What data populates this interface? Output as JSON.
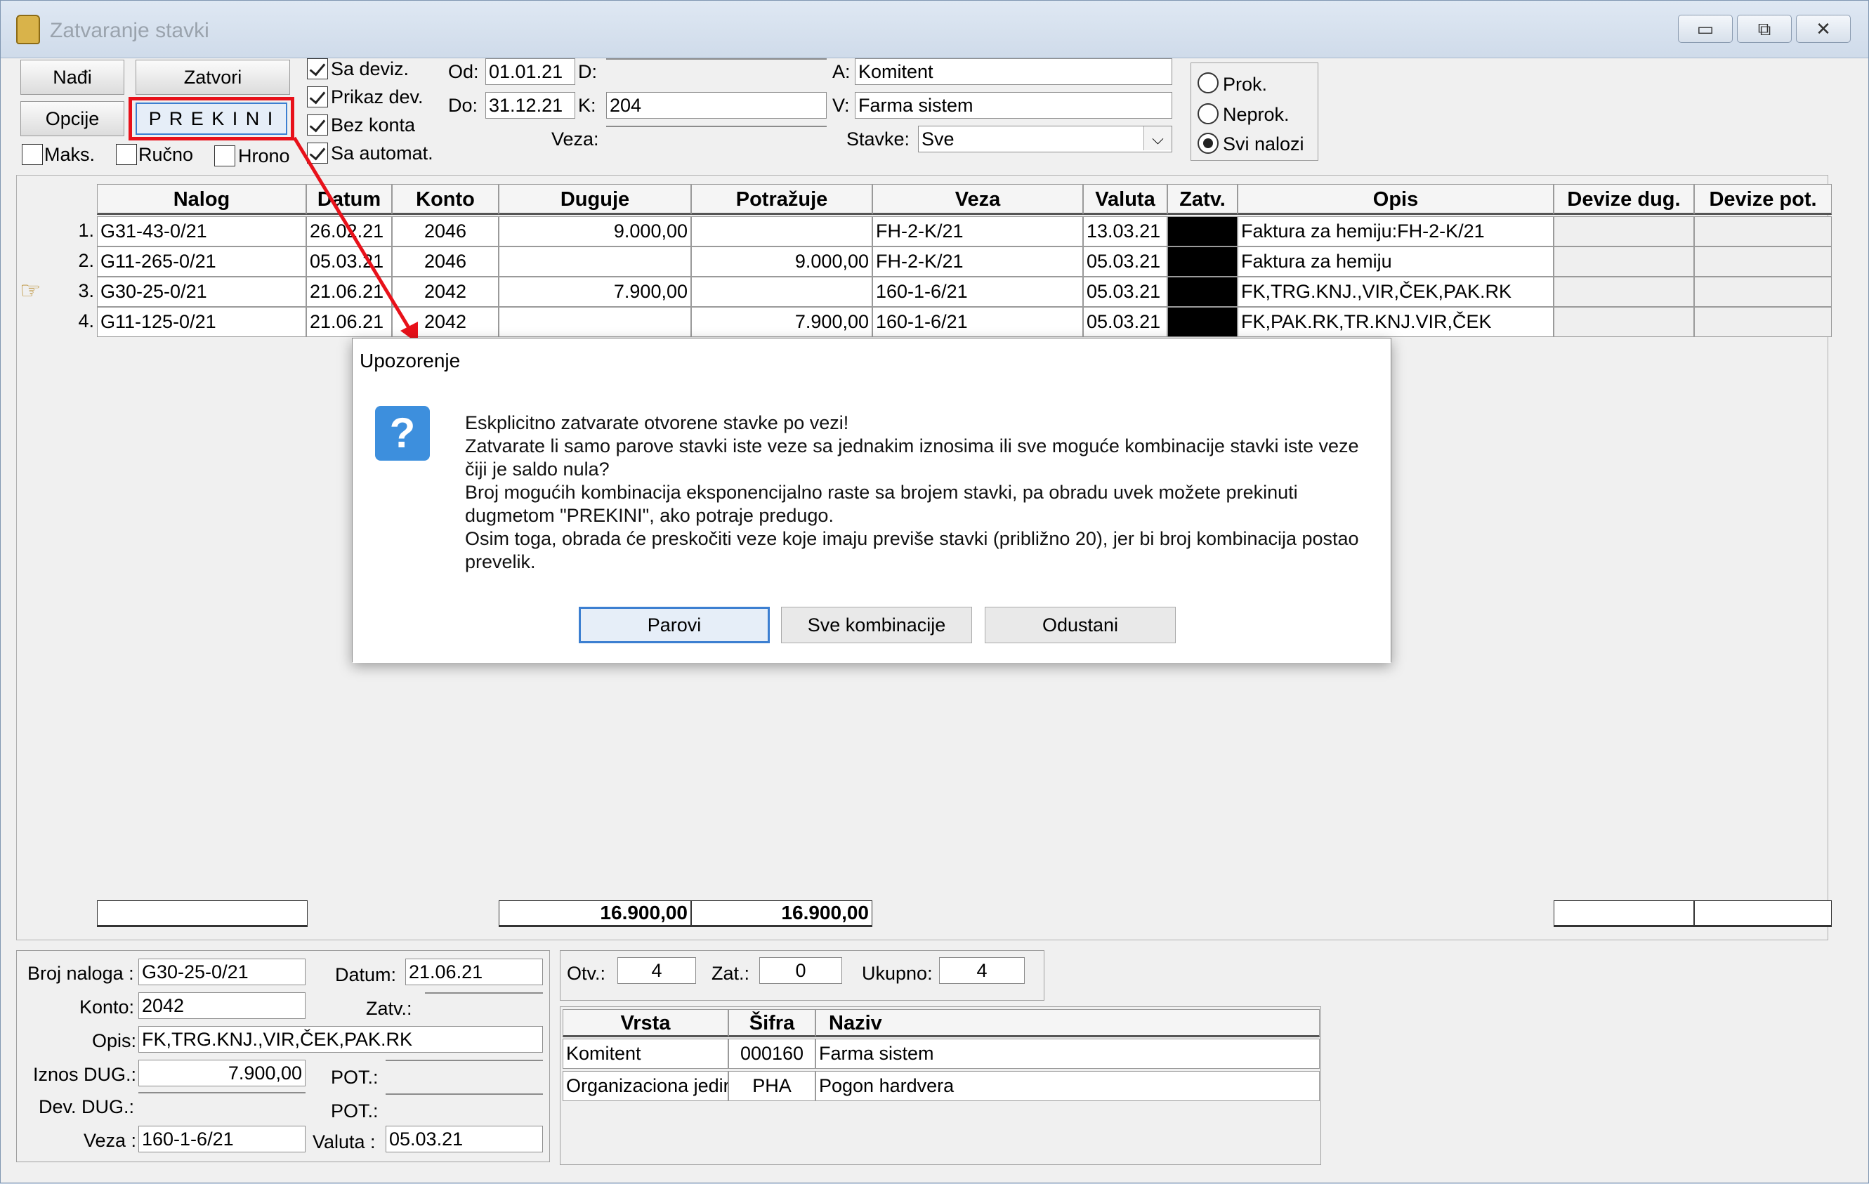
{
  "window": {
    "title": "Zatvaranje stavki"
  },
  "toolbar": {
    "nadji": "Nađi",
    "zatvori": "Zatvori",
    "opcije": "Opcije",
    "prekini": "P R E K I N I",
    "maks": "Maks.",
    "rucno": "Ručno",
    "hrono": "Hrono",
    "sa_deviz": "Sa deviz.",
    "prikaz_dev": "Prikaz dev.",
    "bez_konta": "Bez konta",
    "sa_automat": "Sa automat."
  },
  "filters": {
    "od_label": "Od:",
    "od": "01.01.21",
    "do_label": "Do:",
    "do": "31.12.21",
    "d_label": "D:",
    "d": "",
    "k_label": "K:",
    "k": "204",
    "veza_label": "Veza:",
    "veza": "",
    "a_label": "A:",
    "a": "Komitent",
    "v_label": "V:",
    "v": "Farma sistem",
    "stavke_label": "Stavke:",
    "stavke": "Sve"
  },
  "radios": {
    "prok": "Prok.",
    "neprok": "Neprok.",
    "svi": "Svi nalozi"
  },
  "grid": {
    "headers": [
      "Nalog",
      "Datum",
      "Konto",
      "Duguje",
      "Potražuje",
      "Veza",
      "Valuta",
      "Zatv.",
      "Opis",
      "Devize dug.",
      "Devize pot."
    ],
    "rows": [
      {
        "n": "1.",
        "nalog": "G31-43-0/21",
        "datum": "26.02.21",
        "konto": "2046",
        "duguje": "9.000,00",
        "potrazuje": "",
        "veza": "FH-2-K/21",
        "valuta": "13.03.21",
        "opis": "Faktura za hemiju:FH-2-K/21"
      },
      {
        "n": "2.",
        "nalog": "G11-265-0/21",
        "datum": "05.03.21",
        "konto": "2046",
        "duguje": "",
        "potrazuje": "9.000,00",
        "veza": "FH-2-K/21",
        "valuta": "05.03.21",
        "opis": "Faktura za hemiju"
      },
      {
        "n": "3.",
        "nalog": "G30-25-0/21",
        "datum": "21.06.21",
        "konto": "2042",
        "duguje": "7.900,00",
        "potrazuje": "",
        "veza": "160-1-6/21",
        "valuta": "05.03.21",
        "opis": "FK,TRG.KNJ.,VIR,ČEK,PAK.RK"
      },
      {
        "n": "4.",
        "nalog": "G11-125-0/21",
        "datum": "21.06.21",
        "konto": "2042",
        "duguje": "",
        "potrazuje": "7.900,00",
        "veza": "160-1-6/21",
        "valuta": "05.03.21",
        "opis": "FK,PAK.RK,TR.KNJ.VIR,ČEK"
      }
    ],
    "total_duguje": "16.900,00",
    "total_potrazuje": "16.900,00"
  },
  "details": {
    "broj_label": "Broj naloga :",
    "broj": "G30-25-0/21",
    "datum_label": "Datum:",
    "datum": "21.06.21",
    "konto_label": "Konto:",
    "konto": "2042",
    "zatv_label": "Zatv.:",
    "zatv": "",
    "opis_label": "Opis:",
    "opis": "FK,TRG.KNJ.,VIR,ČEK,PAK.RK",
    "iznos_label": "Iznos DUG.:",
    "iznos": "7.900,00",
    "pot1_label": "POT.:",
    "pot1": "",
    "dev_label": "Dev. DUG.:",
    "dev": "",
    "pot2_label": "POT.:",
    "pot2": "",
    "veza_label": "Veza :",
    "veza": "160-1-6/21",
    "valuta_label": "Valuta :",
    "valuta": "05.03.21"
  },
  "counts": {
    "otv_label": "Otv.:",
    "otv": "4",
    "zat_label": "Zat.:",
    "zat": "0",
    "ukupno_label": "Ukupno:",
    "ukupno": "4"
  },
  "analytics": {
    "headers": [
      "Vrsta",
      "Šifra",
      "Naziv"
    ],
    "rows": [
      {
        "vrsta": "Komitent",
        "sifra": "000160",
        "naziv": "Farma sistem"
      },
      {
        "vrsta": "Organizaciona jedir",
        "sifra": "PHA",
        "naziv": "Pogon hardvera"
      }
    ]
  },
  "dialog": {
    "title": "Upozorenje",
    "lines": [
      "Eskplicitno zatvarate otvorene stavke po vezi!",
      "Zatvarate li samo parove stavki iste veze sa jednakim iznosima ili sve moguće kombinacije stavki iste veze",
      "čiji je saldo nula?",
      "Broj mogućih kombinacija eksponencijalno raste sa brojem stavki, pa obradu uvek možete prekinuti",
      "dugmetom \"PREKINI\", ako potraje predugo.",
      "Osim toga, obrada će preskočiti veze koje imaju previše stavki (približno 20), jer bi broj kombinacija postao",
      "prevelik."
    ],
    "btn_parovi": "Parovi",
    "btn_sve": "Sve kombinacije",
    "btn_odustani": "Odustani"
  },
  "colors": {
    "highlight": "#e8111a",
    "dialog_accent": "#3c7fd1"
  }
}
